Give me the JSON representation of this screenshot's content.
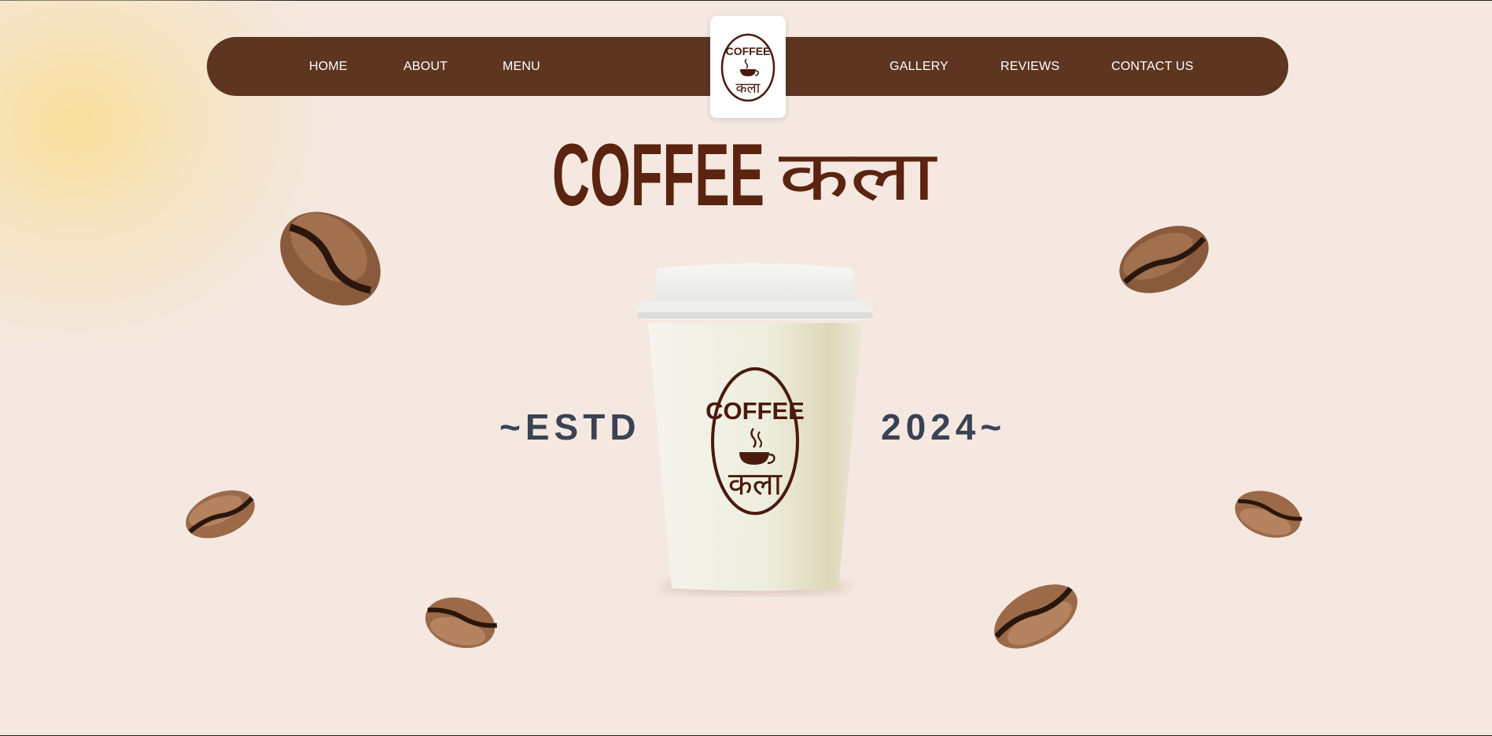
{
  "nav": {
    "left": [
      {
        "label": "HOME"
      },
      {
        "label": "ABOUT"
      },
      {
        "label": "MENU"
      }
    ],
    "right": [
      {
        "label": "GALLERY"
      },
      {
        "label": "REVIEWS"
      },
      {
        "label": "CONTACT US"
      }
    ]
  },
  "brand": {
    "latin": "COFFEE",
    "devanagari": "कला"
  },
  "hero": {
    "estd_label": "~ESTD",
    "year_label": "2024~"
  },
  "colors": {
    "background": "#f4e8e1",
    "nav_bg": "#5d3521",
    "brand_brown": "#5a2410",
    "estd_text": "#3a4254"
  },
  "icons": [
    "coffee-bean-icon",
    "steaming-cup-icon"
  ]
}
